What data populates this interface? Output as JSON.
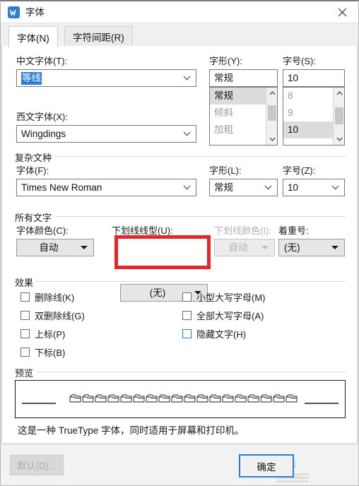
{
  "window": {
    "title": "字体",
    "app_icon": "wps-writer-icon",
    "close_icon": "close-icon",
    "accent_color": "#2a7fd4",
    "annotation_color": "#e8262a"
  },
  "tabs": [
    {
      "label": "字体(N)",
      "active": true
    },
    {
      "label": "字符间距(R)",
      "active": false
    }
  ],
  "latin_cjk": {
    "cjk_font": {
      "label": "中文字体(T):",
      "value": "等线",
      "selected": true
    },
    "latin_font": {
      "label": "西文字体(X):",
      "value": "Wingdings"
    },
    "style": {
      "label": "字形(Y):",
      "value": "常规",
      "options": [
        "常规",
        "倾斜",
        "加粗"
      ],
      "selected_index": 0
    },
    "size": {
      "label": "字号(S):",
      "value": "10",
      "options": [
        "8",
        "9",
        "10"
      ],
      "selected_index": 2
    }
  },
  "complex_script": {
    "group_title": "复杂文种",
    "font": {
      "label": "字体(F):",
      "value": "Times New Roman"
    },
    "style": {
      "label": "字形(L):",
      "value": "常规"
    },
    "size": {
      "label": "字号(Z):",
      "value": "10"
    }
  },
  "all_text": {
    "group_title": "所有文字",
    "font_color": {
      "label": "字体颜色(C):",
      "value": "自动",
      "disabled": false
    },
    "underline_style": {
      "label": "下划线线型(U):",
      "value": "(无)",
      "disabled": false,
      "highlighted": true
    },
    "underline_color": {
      "label": "下划线颜色(I):",
      "value": "自动",
      "disabled": true
    },
    "emphasis_mark": {
      "label": "着重号:",
      "value": "(无)",
      "disabled": false
    }
  },
  "effects": {
    "group_title": "效果",
    "left_column": [
      {
        "label": "删除线(K)",
        "checked": false
      },
      {
        "label": "双删除线(G)",
        "checked": false
      },
      {
        "label": "上标(P)",
        "checked": false
      },
      {
        "label": "下标(B)",
        "checked": false
      }
    ],
    "right_column": [
      {
        "label": "小型大写字母(M)",
        "checked": false
      },
      {
        "label": "全部大写字母(A)",
        "checked": false
      },
      {
        "label": "隐藏文字(H)",
        "checked": false,
        "focused": true
      }
    ]
  },
  "preview": {
    "group_title": "预览",
    "sample_text": "",
    "note": "这是一种 TrueType 字体，同时适用于屏幕和打印机。"
  },
  "footer": {
    "default_button": "默认(D)...",
    "ok_button": "确定"
  }
}
